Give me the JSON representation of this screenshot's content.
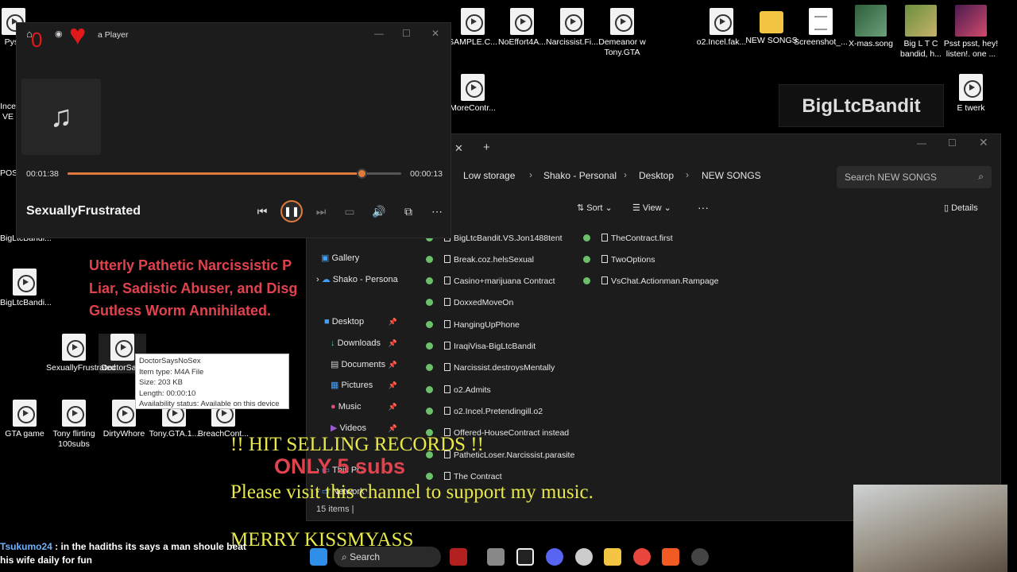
{
  "desktop": {
    "icons": [
      {
        "label": "Pysc"
      },
      {
        "label": "SAMPLE.C..."
      },
      {
        "label": "NoEffort4A..."
      },
      {
        "label": "Narcissist.Fi..."
      },
      {
        "label": "Demeanor w Tony.GTA"
      },
      {
        "label": "o2.Incel.fak..."
      },
      {
        "label": "NEW SONGS"
      },
      {
        "label": "Screenshot_..."
      },
      {
        "label": "X-mas.song"
      },
      {
        "label": "Big L T C bandid, h..."
      },
      {
        "label": "Psst psst, hey! listen!. one ..."
      },
      {
        "label": "MoreContr..."
      },
      {
        "label": "E twerk"
      },
      {
        "label": "BigLtcBandi..."
      },
      {
        "label": "SexuallyFrustrated"
      },
      {
        "label": "DoctorSa..."
      },
      {
        "label": "GTA game"
      },
      {
        "label": "Tony flirting 100subs"
      },
      {
        "label": "DirtyWhore"
      },
      {
        "label": "Tony.GTA.1..."
      },
      {
        "label": "BreachCont..."
      },
      {
        "label": "Ince VE"
      },
      {
        "label": "POS"
      },
      {
        "label": "BigLtcBandi..."
      }
    ],
    "brand_text": "BigLtcBandit",
    "red_text": [
      "Utterly Pathetic Narcissistic P",
      "Liar, Sadistic Abuser, and Disg",
      "Gutless Worm Annihilated."
    ]
  },
  "player": {
    "app_name": "Media Player",
    "app_name_visible": "a Player",
    "heart_count": "0",
    "elapsed": "00:01:38",
    "remaining": "00:00:13",
    "progress": 0.88,
    "song_title": "SexuallyFrustrated",
    "icons": [
      "home-icon",
      "play-icon",
      "music-note-icon",
      "previous-icon",
      "pause-icon",
      "next-icon",
      "subtitles-icon",
      "volume-icon",
      "miniplayer-icon",
      "more-icon"
    ]
  },
  "tooltip": {
    "name": "DoctorSaysNoSex",
    "type": "Item type: M4A File",
    "size": "Size: 203 KB",
    "length": "Length: 00:00:10",
    "availability": "Availability status: Available on this device"
  },
  "explorer": {
    "breadcrumbs": [
      "Low storage",
      "Shako - Personal",
      "Desktop",
      "NEW SONGS"
    ],
    "search_placeholder": "Search NEW SONGS",
    "toolbar": {
      "sort": "Sort",
      "view": "View",
      "more": "···",
      "details": "Details"
    },
    "sidebar": [
      {
        "label": "Gallery"
      },
      {
        "label": "Shako - Persona"
      },
      {
        "label": "Desktop"
      },
      {
        "label": "Downloads"
      },
      {
        "label": "Documents"
      },
      {
        "label": "Pictures"
      },
      {
        "label": "Music"
      },
      {
        "label": "Videos"
      },
      {
        "label": "This PC"
      },
      {
        "label": "Network"
      }
    ],
    "files_col1": [
      "BigLtcBandit.VS.Jon1488tent",
      "Break.coz.helsSexual",
      "Casino+marijuana Contract",
      "DoxxedMoveOn",
      "HangingUpPhone",
      "IraqiVisa-BigLtcBandit",
      "Narcissist.destroysMentally",
      "o2.Admits",
      "o2.Incel.Pretendingill.o2",
      "Offered-HouseContract instead",
      "PatheticLoser.Narcissist.parasite",
      "The Contract"
    ],
    "files_col2": [
      "TheContract.first",
      "TwoOptions",
      "VsChat.Actionman.Rampage"
    ],
    "status": "15 items  |"
  },
  "overlay": {
    "line1": "!! HIT SELLING RECORDS !!",
    "line2": "ONLY 5 subs",
    "line3": "Please visit this channel to support my music.",
    "line4": "MERRY KISSMYASS"
  },
  "chat": {
    "user": "Tsukumo24",
    "message_a": " : in the hadiths its says a man shoule beat",
    "message_b": "his wife daily for fun"
  },
  "taskbar": {
    "search": "Search"
  },
  "colors": {
    "accent": "#e07a3c",
    "sync": "#6cc06c",
    "overlay_yellow": "#e8e84a",
    "overlay_red": "#e0424e"
  }
}
